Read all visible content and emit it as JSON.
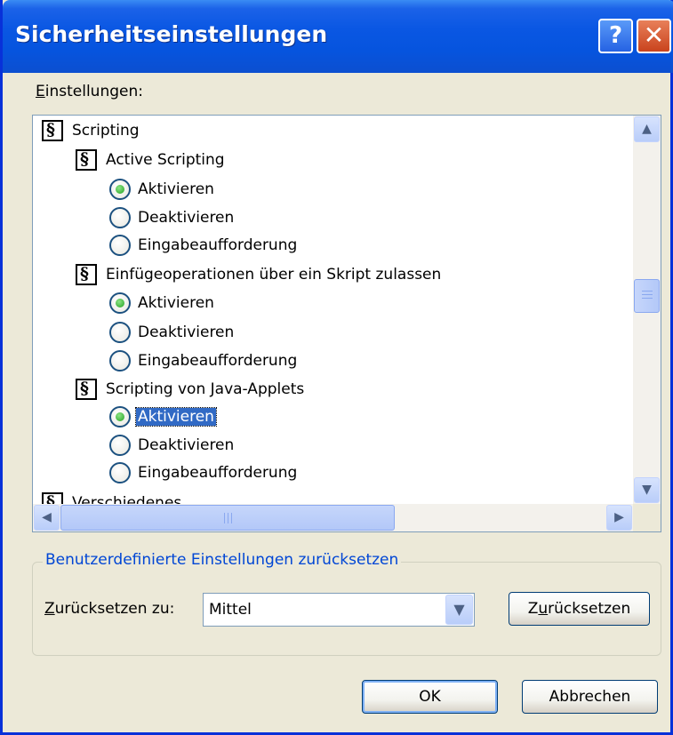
{
  "window": {
    "title": "Sicherheitseinstellungen",
    "help_label": "?",
    "close_label": "✕"
  },
  "settings_label": {
    "accel": "E",
    "rest": "instellungen:"
  },
  "tree": {
    "root": "Scripting",
    "groups": [
      {
        "label": "Active Scripting",
        "options": [
          "Aktivieren",
          "Deaktivieren",
          "Eingabeaufforderung"
        ],
        "selected": 0
      },
      {
        "label": "Einfügeoperationen über ein Skript zulassen",
        "options": [
          "Aktivieren",
          "Deaktivieren",
          "Eingabeaufforderung"
        ],
        "selected": 0
      },
      {
        "label": "Scripting von Java-Applets",
        "options": [
          "Aktivieren",
          "Deaktivieren",
          "Eingabeaufforderung"
        ],
        "selected": 0
      }
    ],
    "next_partial": "Verschiedenes"
  },
  "scroll": {
    "up_arrow": "▲",
    "down_arrow": "▼",
    "left_arrow": "◀",
    "right_arrow": "▶"
  },
  "reset_group": {
    "title": "Benutzerdefinierte Einstellungen zurücksetzen",
    "label_accel": "Z",
    "label_rest": "urücksetzen zu:",
    "combo_value": "Mittel",
    "combo_arrow": "▼",
    "button_pre": "Z",
    "button_accel": "u",
    "button_rest": "rücksetzen"
  },
  "buttons": {
    "ok": "OK",
    "cancel": "Abbrechen"
  },
  "colors": {
    "title_bar": "#0a57e3",
    "selection": "#316ac5",
    "group_title": "#0046d5",
    "dialog_bg": "#ece9d8"
  }
}
